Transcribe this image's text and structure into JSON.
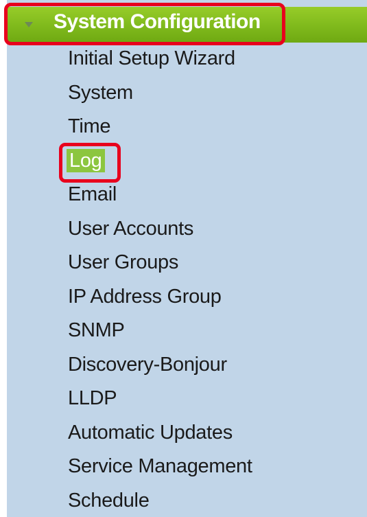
{
  "section": {
    "title": "System Configuration",
    "expanded": true
  },
  "menu": {
    "items": [
      {
        "label": "Initial Setup Wizard"
      },
      {
        "label": "System"
      },
      {
        "label": "Time"
      },
      {
        "label": "Log",
        "selected": true
      },
      {
        "label": "Email"
      },
      {
        "label": "User Accounts"
      },
      {
        "label": "User Groups"
      },
      {
        "label": "IP Address Group"
      },
      {
        "label": "SNMP"
      },
      {
        "label": "Discovery-Bonjour"
      },
      {
        "label": "LLDP"
      },
      {
        "label": "Automatic Updates"
      },
      {
        "label": "Service Management"
      },
      {
        "label": "Schedule"
      }
    ]
  },
  "colors": {
    "panel_background": "#c1d5e8",
    "header_green": "#7fb91c",
    "selected_item_green": "#8cc63f",
    "highlight_red": "#e8001d"
  }
}
